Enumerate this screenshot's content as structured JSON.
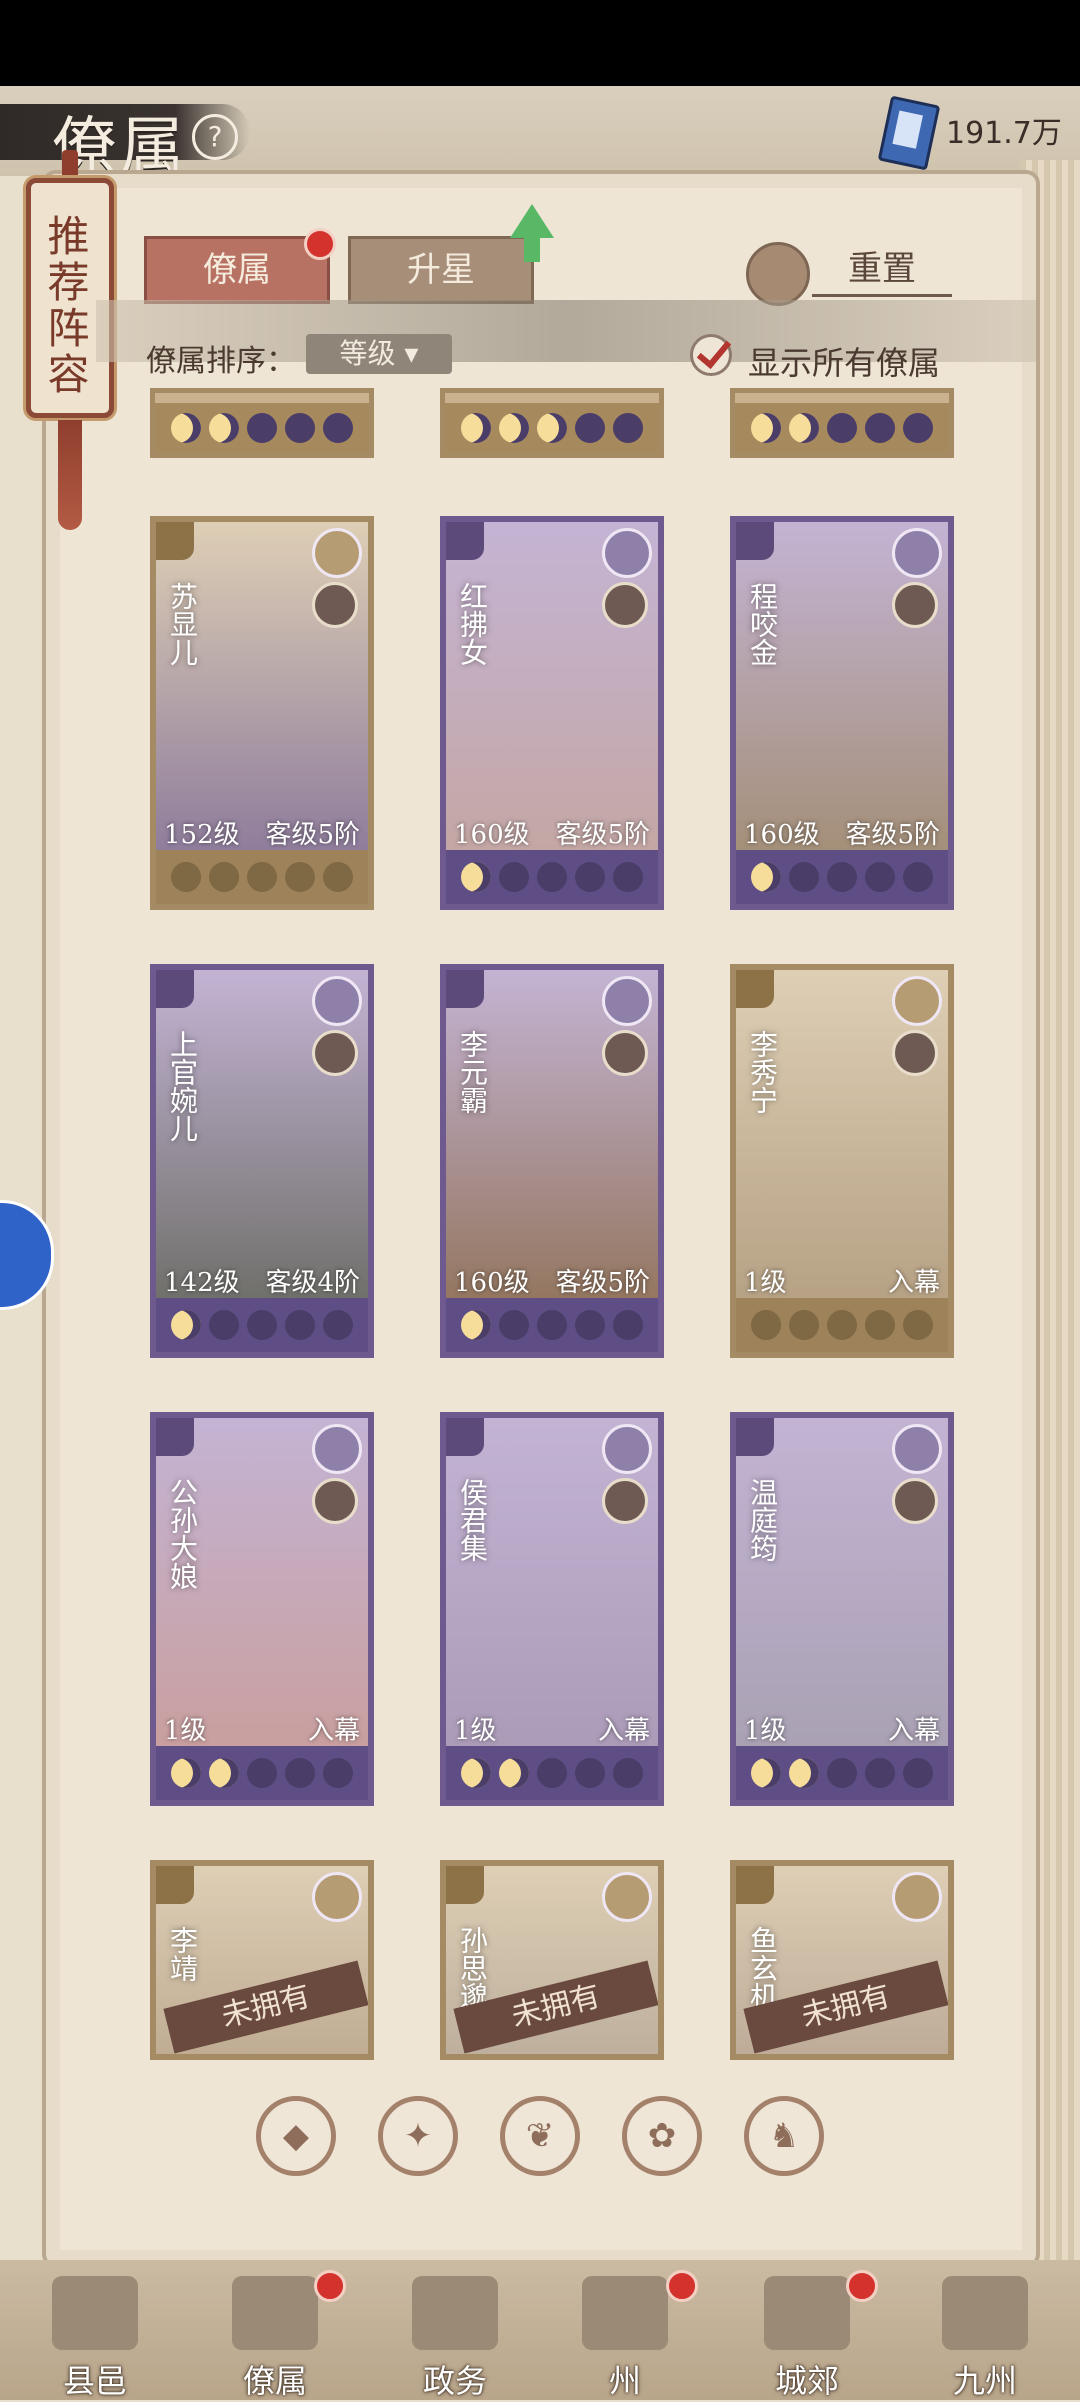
{
  "header": {
    "title": "僚属",
    "help_icon": "?",
    "currency_value": "191.7万"
  },
  "banner": {
    "text": "推荐阵容"
  },
  "tabs": [
    {
      "label": "僚属",
      "active": true,
      "badge": true
    },
    {
      "label": "升星",
      "active": false,
      "badge": false
    }
  ],
  "reset_label": "重置",
  "sort": {
    "label": "僚属排序：",
    "selected": "等级 ▾"
  },
  "show_all_label": "显示所有僚属",
  "cards": [
    {
      "name": "苏显儿",
      "level": "152级",
      "rank": "客级5阶",
      "pips": [
        1,
        1,
        0,
        0,
        0
      ],
      "style": "gold"
    },
    {
      "name": "红拂女",
      "level": "160级",
      "rank": "客级5阶",
      "pips": [
        1,
        0,
        0,
        0,
        0
      ],
      "style": "purple"
    },
    {
      "name": "程咬金",
      "level": "160级",
      "rank": "客级5阶",
      "pips": [
        1,
        0,
        0,
        0,
        0
      ],
      "style": "purple"
    },
    {
      "name": "上官婉儿",
      "level": "142级",
      "rank": "客级4阶",
      "pips": [
        1,
        0,
        0,
        0,
        0
      ],
      "style": "purple"
    },
    {
      "name": "李元霸",
      "level": "160级",
      "rank": "客级5阶",
      "pips": [
        1,
        0,
        0,
        0,
        0
      ],
      "style": "purple"
    },
    {
      "name": "李秀宁",
      "level": "1级",
      "rank": "入幕",
      "pips": [
        1,
        1,
        0,
        0,
        0
      ],
      "style": "gold"
    },
    {
      "name": "公孙大娘",
      "level": "1级",
      "rank": "入幕",
      "pips": [
        1,
        1,
        0,
        0,
        0
      ],
      "style": "purple"
    },
    {
      "name": "侯君集",
      "level": "1级",
      "rank": "入幕",
      "pips": [
        1,
        1,
        0,
        0,
        0
      ],
      "style": "purple"
    },
    {
      "name": "温庭筠",
      "level": "1级",
      "rank": "入幕",
      "pips": [
        1,
        1,
        0,
        0,
        0
      ],
      "style": "purple"
    },
    {
      "name": "李靖",
      "level": "",
      "rank": "",
      "pips": [],
      "style": "gold",
      "not_owned": "未拥有"
    },
    {
      "name": "孙思邈",
      "level": "",
      "rank": "",
      "pips": [],
      "style": "gold",
      "not_owned": "未拥有"
    },
    {
      "name": "鱼玄机",
      "level": "",
      "rank": "",
      "pips": [],
      "style": "gold",
      "not_owned": "未拥有"
    }
  ],
  "filters": [
    {
      "icon": "◆",
      "active": true
    },
    {
      "icon": "✦",
      "active": false
    },
    {
      "icon": "❦",
      "active": false
    },
    {
      "icon": "✿",
      "active": false
    },
    {
      "icon": "♞",
      "active": false
    }
  ],
  "nav": [
    {
      "label": "县邑",
      "badge": false
    },
    {
      "label": "僚属",
      "badge": true
    },
    {
      "label": "政务",
      "badge": false
    },
    {
      "label": "州",
      "badge": true
    },
    {
      "label": "城郊",
      "badge": true
    },
    {
      "label": "九州",
      "badge": false
    }
  ]
}
